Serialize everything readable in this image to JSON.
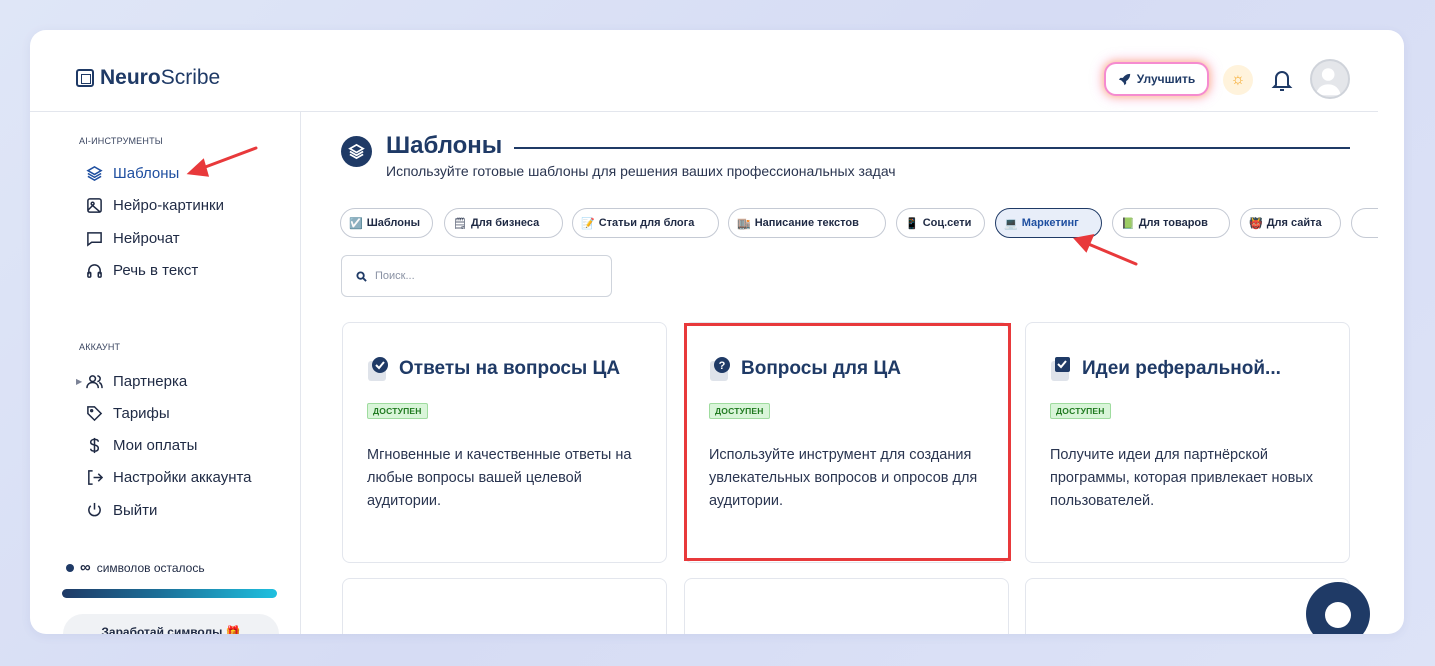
{
  "app": {
    "logo_bold": "Neuro",
    "logo_light": "Scribe"
  },
  "header": {
    "upgrade_label": "Улучшить"
  },
  "sidebar": {
    "section_tools": "AI-ИНСТРУМЕНТЫ",
    "tools": [
      {
        "label": "Шаблоны",
        "icon": "layers-icon"
      },
      {
        "label": "Нейро-картинки",
        "icon": "image-icon"
      },
      {
        "label": "Нейрочат",
        "icon": "chat-icon"
      },
      {
        "label": "Речь в текст",
        "icon": "headphones-icon"
      }
    ],
    "section_account": "АККАУНТ",
    "account": [
      {
        "label": "Партнерка",
        "icon": "users-icon"
      },
      {
        "label": "Тарифы",
        "icon": "tag-icon"
      },
      {
        "label": "Мои оплаты",
        "icon": "dollar-icon"
      },
      {
        "label": "Настройки аккаунта",
        "icon": "exit-arrow-icon"
      },
      {
        "label": "Выйти",
        "icon": "power-icon"
      }
    ],
    "counter_symbol": "∞",
    "counter_text": "символов осталось",
    "earn_label": "Заработай символы 🎁"
  },
  "main": {
    "title": "Шаблоны",
    "subtitle": "Используйте готовые шаблоны для решения ваших профессиональных задач",
    "chips": [
      {
        "emoji": "☑️",
        "label": "Шаблоны"
      },
      {
        "emoji": "🗒",
        "label": "Для бизнеса"
      },
      {
        "emoji": "📝",
        "label": "Статьи для блога"
      },
      {
        "emoji": "🏬",
        "label": "Написание текстов"
      },
      {
        "emoji": "📱",
        "label": "Соц.сети"
      },
      {
        "emoji": "💻",
        "label": "Маркетинг"
      },
      {
        "emoji": "📗",
        "label": "Для товаров"
      },
      {
        "emoji": "👹",
        "label": "Для сайта"
      }
    ],
    "active_chip": "Маркетинг",
    "search_placeholder": "Поиск...",
    "cards": [
      {
        "icon": "check-badge-icon",
        "title": "Ответы на вопросы ЦА",
        "badge": "ДОСТУПЕН",
        "desc": "Мгновенные и качественные ответы на любые вопросы вашей целевой аудитории."
      },
      {
        "icon": "question-icon",
        "title": "Вопросы для ЦА",
        "badge": "ДОСТУПЕН",
        "desc": "Используйте инструмент для создания увлекательных вопросов и опросов для аудитории."
      },
      {
        "icon": "checkbox-icon",
        "title": "Идеи реферальной...",
        "badge": "ДОСТУПЕН",
        "desc": "Получите идеи для партнёрской программы, которая привлекает новых пользователей."
      }
    ]
  },
  "colors": {
    "accent": "#1f3a66",
    "highlight": "#e8393b",
    "badge_bg": "#d9f5d9"
  }
}
